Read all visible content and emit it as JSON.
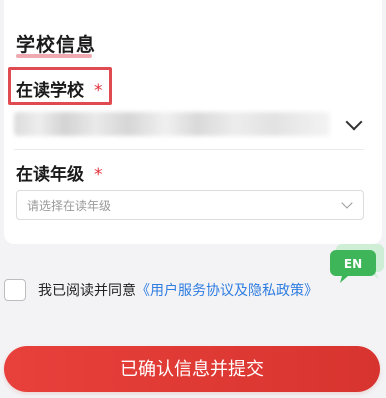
{
  "section": {
    "title": "学校信息"
  },
  "school_field": {
    "label": "在读学校",
    "required_mark": "*"
  },
  "grade_field": {
    "label": "在读年级",
    "required_mark": "*",
    "placeholder": "请选择在读年级"
  },
  "agreement": {
    "text": "我已阅读并同意",
    "link": "《用户服务协议及隐私政策》",
    "checked": false
  },
  "floating_button": {
    "label": "EN",
    "color": "#3fb55a"
  },
  "submit": {
    "label": "已确认信息并提交",
    "color": "#e33d38"
  },
  "colors": {
    "accent": "#e33d38",
    "required": "#e0323a",
    "link": "#2f7de1",
    "highlight": "#e04b52"
  }
}
